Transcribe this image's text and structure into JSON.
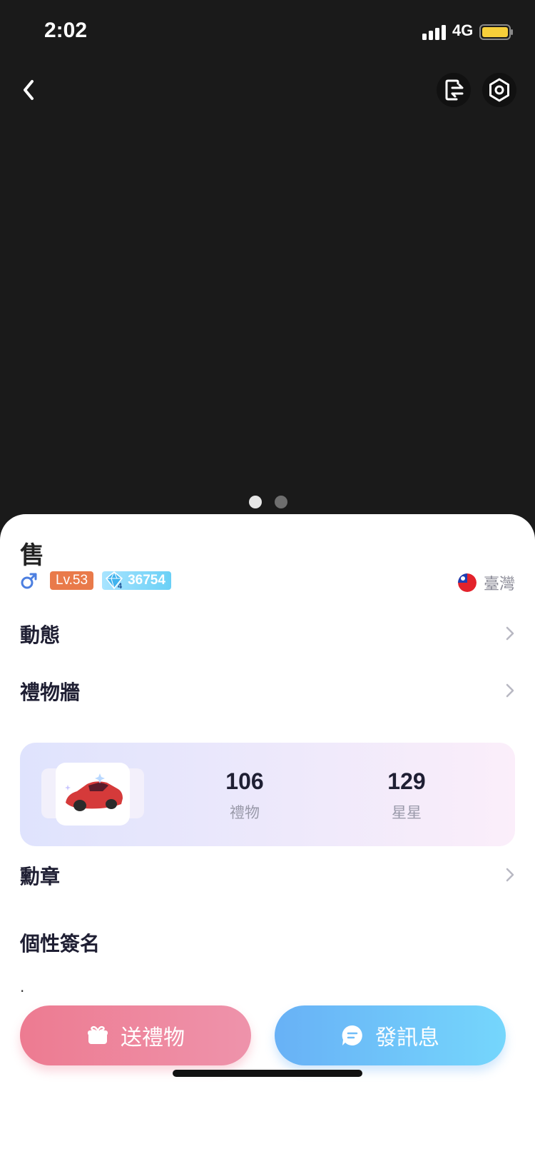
{
  "status_bar": {
    "time": "2:02",
    "network": "4G"
  },
  "profile": {
    "name": "售",
    "level": "Lv.53",
    "diamond_tier": "4",
    "diamonds": "36754",
    "region": "臺灣"
  },
  "sections": {
    "moments": "動態",
    "gift_wall": "禮物牆",
    "medals": "勳章",
    "signature": "個性簽名"
  },
  "gift_stats": {
    "gifts_count": "106",
    "gifts_label": "禮物",
    "stars_count": "129",
    "stars_label": "星星"
  },
  "signature_text": ".",
  "actions": {
    "send_gift": "送禮物",
    "send_message": "發訊息"
  },
  "colors": {
    "hero_bg": "#1a1a1a",
    "level_badge": "#e97a4a",
    "gift_button": "#ed7b91",
    "message_button": "#68b1f6"
  },
  "icons": [
    "back-arrow-icon",
    "switch-account-icon",
    "settings-icon",
    "male-gender-icon",
    "diamond-icon",
    "taiwan-flag-icon",
    "chevron-right-icon",
    "gift-icon",
    "chat-bubble-icon"
  ],
  "carousel": {
    "pages": 2,
    "active_index": 0
  }
}
